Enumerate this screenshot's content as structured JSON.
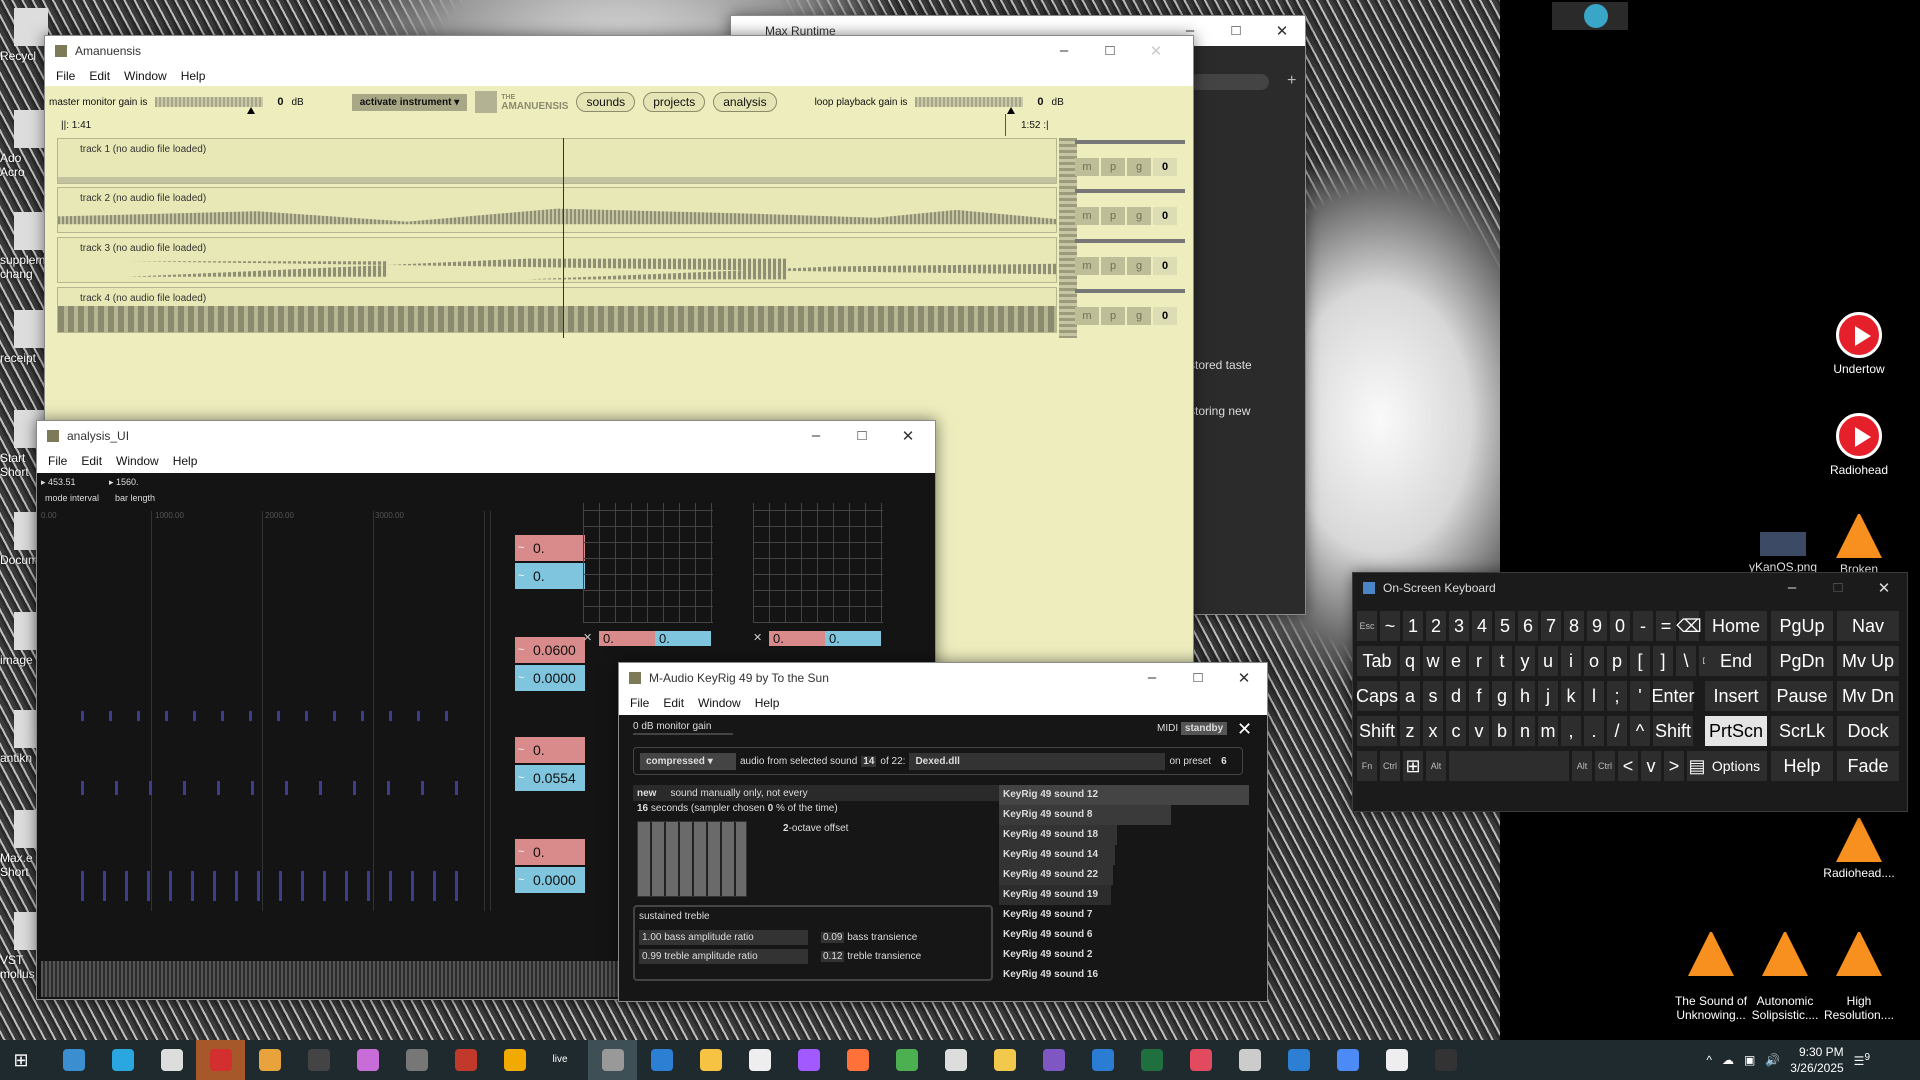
{
  "desktop": {
    "left_icons": [
      {
        "label": "Recycl",
        "icon": "recycle-bin-icon"
      },
      {
        "label": "Ado\nAcro",
        "icon": "acrobat-icon"
      },
      {
        "label": "supplem\nchang",
        "icon": "document-icon"
      },
      {
        "label": "receipt",
        "icon": "pdf-icon"
      },
      {
        "label": "Start\nShort",
        "icon": "shortcut-icon"
      },
      {
        "label": "Docum",
        "icon": "document-icon"
      },
      {
        "label": "image",
        "icon": "image-icon"
      },
      {
        "label": "antikn",
        "icon": "gear-icon"
      },
      {
        "label": "Max.e\nShort",
        "icon": "max-icon"
      },
      {
        "label": "VST\nmollus",
        "icon": "max-icon"
      }
    ],
    "right_icons": [
      {
        "label": "Undertow",
        "icon": "youtube-icon"
      },
      {
        "label": "Radiohead",
        "icon": "youtube-icon"
      },
      {
        "label": "Broken",
        "icon": "vlc-icon"
      },
      {
        "label": "yKanOS.png",
        "icon": "image-icon"
      },
      {
        "label": "Radiohead....",
        "icon": "vlc-icon"
      },
      {
        "label": "The Sound of\nUnknowing...",
        "icon": "vlc-icon"
      },
      {
        "label": "Autonomic\nSolipsistic....",
        "icon": "vlc-icon"
      },
      {
        "label": "High\nResolution....",
        "icon": "vlc-icon"
      }
    ]
  },
  "max_runtime": {
    "title": "Max Runtime",
    "lines": [
      "stored taste",
      "storing new"
    ]
  },
  "amanuensis": {
    "title": "Amanuensis",
    "menu": [
      "File",
      "Edit",
      "Window",
      "Help"
    ],
    "master_gain_label": "master monitor gain is",
    "master_gain_value": "0",
    "master_gain_unit": "dB",
    "instrument_menu": "activate instrument",
    "logo_small": "THE",
    "logo": "AMANUENSIS",
    "nav": [
      "sounds",
      "projects",
      "analysis"
    ],
    "loop_gain_label": "loop playback gain is",
    "loop_gain_value": "0",
    "loop_gain_unit": "dB",
    "time_start": "||: 1:41",
    "time_end": "1:52 :|",
    "tracks": [
      {
        "label": "track 1 (no audio file loaded)"
      },
      {
        "label": "track 2 (no audio file loaded)"
      },
      {
        "label": "track 3 (no audio file loaded)"
      },
      {
        "label": "track 4 (no audio file loaded)"
      }
    ],
    "track_buttons": [
      "m",
      "p",
      "g",
      "0"
    ]
  },
  "analysis": {
    "title": "analysis_UI",
    "menu": [
      "File",
      "Edit",
      "Window",
      "Help"
    ],
    "mode_interval_value": "453.51",
    "bar_length_value": "1560.",
    "mode_interval_label": "mode interval",
    "bar_length_label": "bar length",
    "axis_ticks": [
      "0.00",
      "1000.00",
      "2000.00",
      "3000.00"
    ],
    "boxes": [
      {
        "value": "0.",
        "color": "pink"
      },
      {
        "value": "0.",
        "color": "cyan"
      },
      {
        "value": "0.0600",
        "color": "pink"
      },
      {
        "value": "0.0000",
        "color": "cyan"
      },
      {
        "value": "0.",
        "color": "pink"
      },
      {
        "value": "0.0554",
        "color": "cyan"
      },
      {
        "value": "0.",
        "color": "pink"
      },
      {
        "value": "0.0000",
        "color": "cyan"
      }
    ],
    "grid_boxes": [
      {
        "pink": "0.",
        "cyan": "0."
      },
      {
        "pink": "0.",
        "cyan": "0."
      }
    ]
  },
  "keyrig": {
    "title": "M-Audio KeyRig 49 by To the Sun",
    "menu": [
      "File",
      "Edit",
      "Window",
      "Help"
    ],
    "monitor_gain": "0 dB monitor gain",
    "midi_label": "MIDI",
    "midi_state": "standby",
    "mode": "compressed",
    "audio_from_text": "audio from selected sound",
    "sound_index": "14",
    "sound_of": "of 22:",
    "plugin": "Dexed.dll",
    "on_preset_label": "on preset",
    "preset": "6",
    "new_label": "new",
    "sound_mode": "sound manually only, not every",
    "seconds_value": "16",
    "seconds_text": "seconds (sampler chosen",
    "percent_value": "0",
    "percent_text": "% of the time)",
    "octave_value": "2",
    "octave_text": "-octave offset",
    "sound_list": [
      "KeyRig 49 sound 12",
      "KeyRig 49 sound 8",
      "KeyRig 49 sound 18",
      "KeyRig 49 sound 14",
      "KeyRig 49 sound 22",
      "KeyRig 49 sound 19",
      "KeyRig 49 sound 7",
      "KeyRig 49 sound 6",
      "KeyRig 49 sound 2",
      "KeyRig 49 sound 16"
    ],
    "character": "sustained treble",
    "params": [
      {
        "value": "1.00",
        "label": "bass amplitude ratio"
      },
      {
        "value": "0.09",
        "label": "bass transience"
      },
      {
        "value": "0.99",
        "label": "treble amplitude ratio"
      },
      {
        "value": "0.12",
        "label": "treble transience"
      }
    ]
  },
  "osk": {
    "title": "On-Screen Keyboard",
    "row1": [
      "Esc",
      "~",
      "1",
      "2",
      "3",
      "4",
      "5",
      "6",
      "7",
      "8",
      "9",
      "0",
      "-",
      "=",
      "⌫"
    ],
    "row2": [
      "Tab",
      "q",
      "w",
      "e",
      "r",
      "t",
      "y",
      "u",
      "i",
      "o",
      "p",
      "[",
      "]",
      "\\",
      "Del"
    ],
    "row3": [
      "Caps",
      "a",
      "s",
      "d",
      "f",
      "g",
      "h",
      "j",
      "k",
      "l",
      ";",
      "'",
      "Enter"
    ],
    "row4": [
      "Shift",
      "z",
      "x",
      "c",
      "v",
      "b",
      "n",
      "m",
      ",",
      ".",
      "/",
      "^",
      "Shift"
    ],
    "row5": [
      "Fn",
      "Ctrl",
      "⊞",
      "Alt",
      "",
      "Alt",
      "Ctrl",
      "<",
      "v",
      ">",
      "▤"
    ],
    "nav_keys": [
      [
        "Home",
        "PgUp",
        "Nav"
      ],
      [
        "End",
        "PgDn",
        "Mv Up"
      ],
      [
        "Insert",
        "Pause",
        "Mv Dn"
      ],
      [
        "PrtScn",
        "ScrLk",
        "Dock"
      ],
      [
        "Options",
        "Help",
        "Fade"
      ]
    ]
  },
  "taskbar": {
    "time": "9:30 PM",
    "date": "3/26/2025",
    "notification_count": "9",
    "apps": [
      "start-icon",
      "settings-icon",
      "cortana-icon",
      "max-icon",
      "app-red-icon",
      "app-paint-icon",
      "app-dark-icon",
      "app-colors-icon",
      "app-label-icon",
      "voicemeeter-icon",
      "app-fl-icon",
      "live-icon",
      "max-icon",
      "app-blue-icon",
      "explorer-icon",
      "app-flame-icon",
      "app-purple-icon",
      "firefox-icon",
      "chrome-icon",
      "max-icon",
      "app-folder-icon",
      "app-diamond-icon",
      "vscode-icon",
      "terminal-icon",
      "app-colors-icon",
      "app-window-icon",
      "app-monitor-icon",
      "app-blocks-icon",
      "app-flame-icon",
      "cmd-icon"
    ],
    "live_label": "live"
  }
}
